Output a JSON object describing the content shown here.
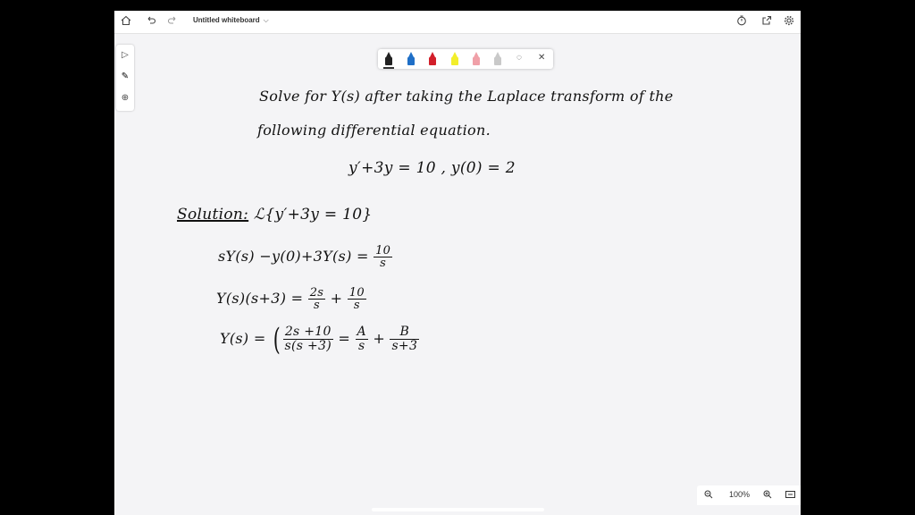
{
  "toolbar": {
    "title": "Untitled whiteboard",
    "icons": [
      "home-icon",
      "undo-icon",
      "redo-icon",
      "chevron-down-icon",
      "timer-icon",
      "share-icon",
      "gear-icon"
    ]
  },
  "left_tools": [
    "select-icon",
    "pen-icon",
    "add-icon"
  ],
  "pen_tray": {
    "pens": [
      {
        "name": "black-pen",
        "color": "#222222",
        "selected": true
      },
      {
        "name": "blue-pen",
        "color": "#1f6fc7",
        "selected": false
      },
      {
        "name": "red-pen",
        "color": "#d21f2a",
        "selected": false
      },
      {
        "name": "yellow-highlighter",
        "color": "#f2ee2b",
        "selected": false
      },
      {
        "name": "pink-eraser",
        "color": "#f0a0a8",
        "selected": false
      },
      {
        "name": "ruler",
        "color": "#c9c9c9",
        "selected": false
      }
    ]
  },
  "content": {
    "line1": "Solve for Y(s) after taking the Laplace transform of the",
    "line2": "following differential equation.",
    "equation": "y′+3y = 10  , y(0) = 2",
    "solution_label": "Solution:",
    "solution_expr": "ℒ{y′+3y = 10}",
    "step1_lhs": "sY(s) −y(0)+3Y(s) =",
    "step1_num": "10",
    "step1_den": "s",
    "step2_lhs": "Y(s)(s+3) =",
    "step2_num1": "2s",
    "step2_den1": "s",
    "step2_plus": "+",
    "step2_num2": "10",
    "step2_den2": "s",
    "step3_lhs": "Y(s) =",
    "step3_num": "2s +10",
    "step3_den": "s(s +3)",
    "step3_eq": "=",
    "step3_A": "A",
    "step3_Aden": "s",
    "step3_plus": "+",
    "step3_B": "B",
    "step3_Bden": "s+3"
  },
  "zoom": {
    "level": "100%"
  }
}
